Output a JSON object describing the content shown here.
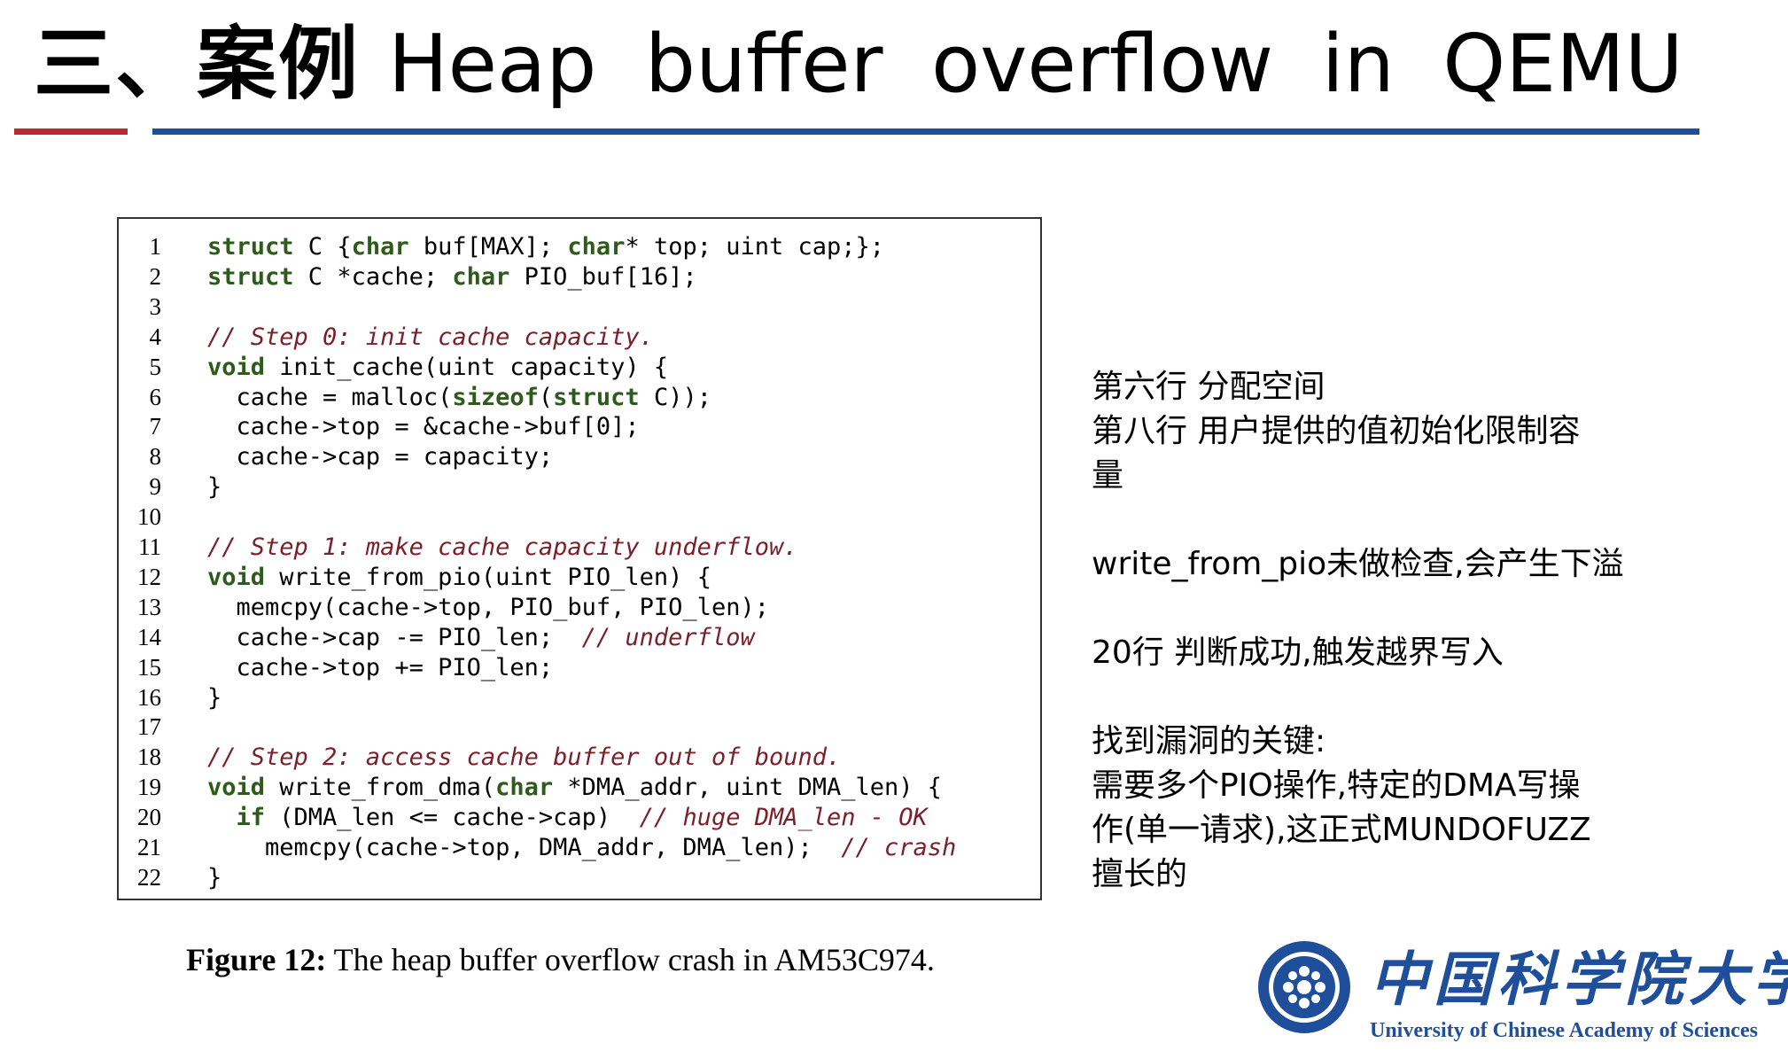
{
  "title": {
    "prefix": "三、案例",
    "text": "Heap buffer overflow in QEMU"
  },
  "code": [
    {
      "n": "1",
      "tokens": [
        {
          "t": "kw",
          "v": "struct"
        },
        {
          "t": "p",
          "v": " C {"
        },
        {
          "t": "kw",
          "v": "char"
        },
        {
          "t": "p",
          "v": " buf[MAX]; "
        },
        {
          "t": "kw",
          "v": "char"
        },
        {
          "t": "p",
          "v": "* top; uint cap;};"
        }
      ]
    },
    {
      "n": "2",
      "tokens": [
        {
          "t": "kw",
          "v": "struct"
        },
        {
          "t": "p",
          "v": " C *cache; "
        },
        {
          "t": "kw",
          "v": "char"
        },
        {
          "t": "p",
          "v": " PIO_buf[16];"
        }
      ]
    },
    {
      "n": "3",
      "tokens": []
    },
    {
      "n": "4",
      "tokens": [
        {
          "t": "cm",
          "v": "// Step 0: init cache capacity."
        }
      ]
    },
    {
      "n": "5",
      "tokens": [
        {
          "t": "kw",
          "v": "void"
        },
        {
          "t": "p",
          "v": " init_cache(uint capacity) {"
        }
      ]
    },
    {
      "n": "6",
      "tokens": [
        {
          "t": "p",
          "v": "  cache = malloc("
        },
        {
          "t": "kw",
          "v": "sizeof"
        },
        {
          "t": "p",
          "v": "("
        },
        {
          "t": "kw",
          "v": "struct"
        },
        {
          "t": "p",
          "v": " C));"
        }
      ]
    },
    {
      "n": "7",
      "tokens": [
        {
          "t": "p",
          "v": "  cache->top = &cache->buf[0];"
        }
      ]
    },
    {
      "n": "8",
      "tokens": [
        {
          "t": "p",
          "v": "  cache->cap = capacity;"
        }
      ]
    },
    {
      "n": "9",
      "tokens": [
        {
          "t": "p",
          "v": "}"
        }
      ]
    },
    {
      "n": "10",
      "tokens": []
    },
    {
      "n": "11",
      "tokens": [
        {
          "t": "cm",
          "v": "// Step 1: make cache capacity underflow."
        }
      ]
    },
    {
      "n": "12",
      "tokens": [
        {
          "t": "kw",
          "v": "void"
        },
        {
          "t": "p",
          "v": " write_from_pio(uint PIO_len) {"
        }
      ]
    },
    {
      "n": "13",
      "tokens": [
        {
          "t": "p",
          "v": "  memcpy(cache->top, PIO_buf, PIO_len);"
        }
      ]
    },
    {
      "n": "14",
      "tokens": [
        {
          "t": "p",
          "v": "  cache->cap -= PIO_len;  "
        },
        {
          "t": "cm",
          "v": "// underflow"
        }
      ]
    },
    {
      "n": "15",
      "tokens": [
        {
          "t": "p",
          "v": "  cache->top += PIO_len;"
        }
      ]
    },
    {
      "n": "16",
      "tokens": [
        {
          "t": "p",
          "v": "}"
        }
      ]
    },
    {
      "n": "17",
      "tokens": []
    },
    {
      "n": "18",
      "tokens": [
        {
          "t": "cm",
          "v": "// Step 2: access cache buffer out of bound."
        }
      ]
    },
    {
      "n": "19",
      "tokens": [
        {
          "t": "kw",
          "v": "void"
        },
        {
          "t": "p",
          "v": " write_from_dma("
        },
        {
          "t": "kw",
          "v": "char"
        },
        {
          "t": "p",
          "v": " *DMA_addr, uint DMA_len) {"
        }
      ]
    },
    {
      "n": "20",
      "tokens": [
        {
          "t": "p",
          "v": "  "
        },
        {
          "t": "kw",
          "v": "if"
        },
        {
          "t": "p",
          "v": " (DMA_len <= cache->cap)  "
        },
        {
          "t": "cm",
          "v": "// huge DMA_len - OK"
        }
      ]
    },
    {
      "n": "21",
      "tokens": [
        {
          "t": "p",
          "v": "    memcpy(cache->top, DMA_addr, DMA_len);  "
        },
        {
          "t": "cm",
          "v": "// crash"
        }
      ]
    },
    {
      "n": "22",
      "tokens": [
        {
          "t": "p",
          "v": "}"
        }
      ]
    }
  ],
  "caption": {
    "label": "Figure 12:",
    "text": " The heap buffer overflow crash in AM53C974."
  },
  "notes": [
    "第六行 分配空间",
    "第八行 用户提供的值初始化限制容",
    "量",
    "",
    "write_from_pio未做检查,会产生下溢",
    "",
    "20行 判断成功,触发越界写入",
    "",
    "找到漏洞的关键:",
    "需要多个PIO操作,特定的DMA写操",
    "作(单一请求),这正式MUNDOFUZZ",
    "擅长的"
  ],
  "logo": {
    "cn": "中国科学院大学",
    "en": "University of Chinese Academy of Sciences",
    "emblem_ring_text": "CHINESE ACADEMY OF SCIENCES",
    "color": "#1f4e9a"
  },
  "colors": {
    "keyword": "#2e5b1c",
    "comment": "#7a1f2b",
    "title_red": "#c0282d",
    "title_blue": "#1f4e9a"
  }
}
